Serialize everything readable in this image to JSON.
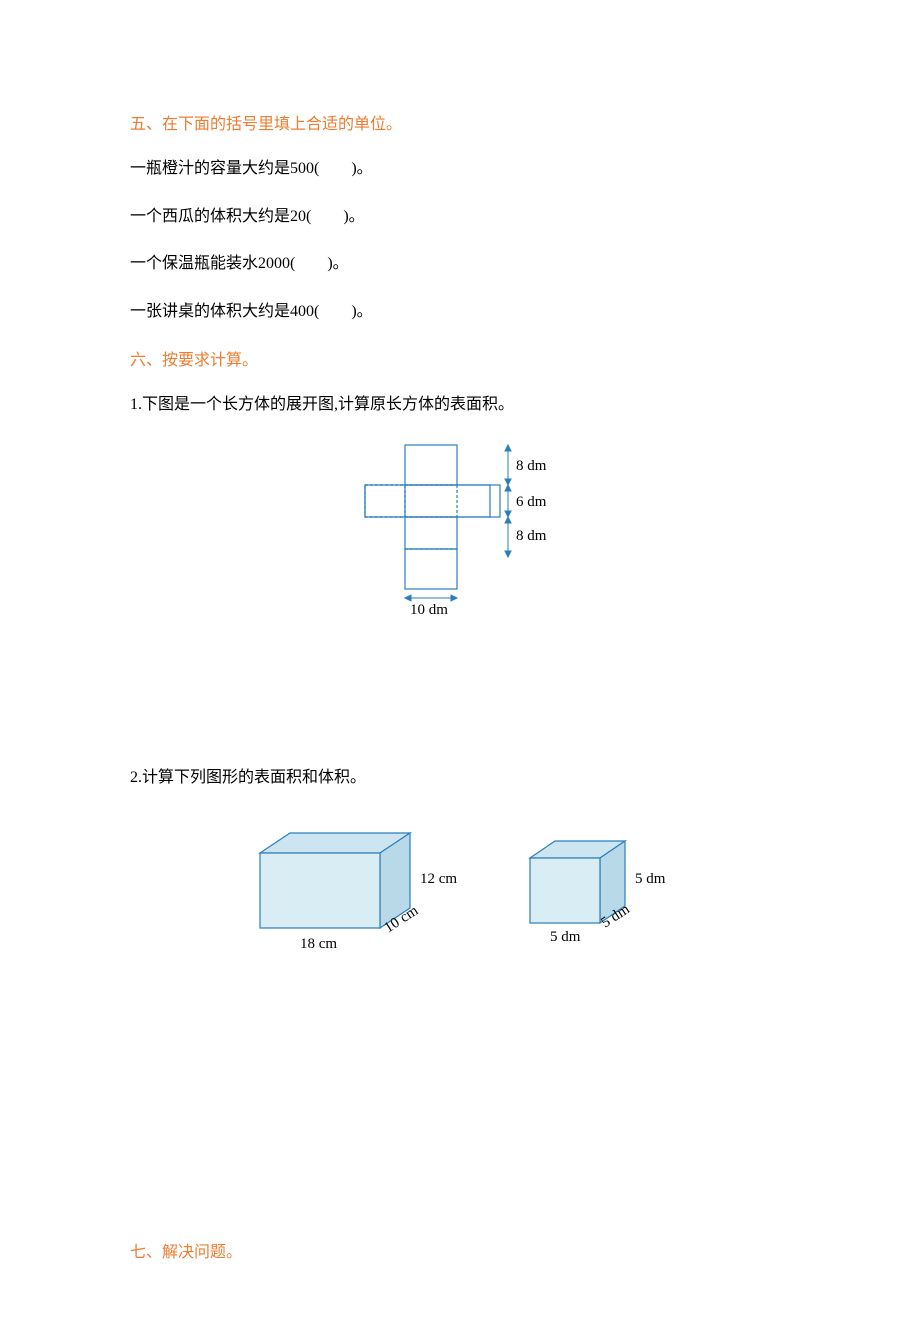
{
  "section5": {
    "heading": "五、在下面的括号里填上合适的单位。",
    "q1": "一瓶橙汁的容量大约是500(　　)。",
    "q2": "一个西瓜的体积大约是20(　　)。",
    "q3": "一个保温瓶能装水2000(　　)。",
    "q4": "一张讲桌的体积大约是400(　　)。"
  },
  "section6": {
    "heading": "六、按要求计算。",
    "q1": "1.下图是一个长方体的展开图,计算原长方体的表面积。",
    "fig1": {
      "label_8dm_a": "8 dm",
      "label_6dm": "6 dm",
      "label_8dm_b": "8 dm",
      "label_10dm": "10 dm"
    },
    "q2": "2.计算下列图形的表面积和体积。",
    "fig2": {
      "cuboid_18": "18 cm",
      "cuboid_10": "10 cm",
      "cuboid_12": "12 cm",
      "cube_5a": "5 dm",
      "cube_5b": "5 dm",
      "cube_5c": "5 dm"
    }
  },
  "section7": {
    "heading": "七、解决问题。"
  }
}
